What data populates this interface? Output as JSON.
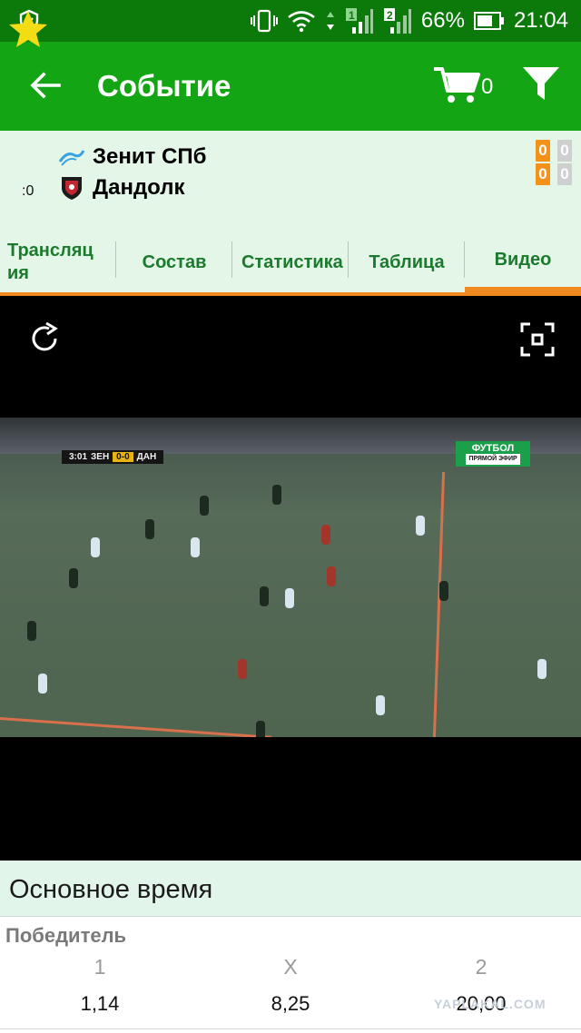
{
  "status_bar": {
    "battery_percent": "66%",
    "time": "21:04",
    "sim1_badge": "1",
    "sim2_badge": "2"
  },
  "app_bar": {
    "title": "Событие",
    "cart_count": "0"
  },
  "match": {
    "favorite_count": ":0",
    "team1": "Зенит СПб",
    "team2": "Дандолк",
    "score_current": [
      "0",
      "0"
    ],
    "score_other": [
      "0",
      "0"
    ]
  },
  "tabs": [
    {
      "label": "Трансляция",
      "active": false
    },
    {
      "label": "Состав",
      "active": false
    },
    {
      "label": "Статистика",
      "active": false
    },
    {
      "label": "Таблица",
      "active": false
    },
    {
      "label": "Видео",
      "active": true
    }
  ],
  "video": {
    "overlay_clock": "3:01",
    "overlay_team1": "ЗЕН",
    "overlay_score": "0-0",
    "overlay_team2": "ДАН",
    "channel_name": "ФУТБОЛ",
    "channel_sub": "ПРЯМОЙ ЭФИР"
  },
  "section": {
    "title": "Основное время"
  },
  "market": {
    "title": "Победитель",
    "outcomes": [
      {
        "label": "1",
        "odds": "1,14"
      },
      {
        "label": "X",
        "odds": "8,25"
      },
      {
        "label": "2",
        "odds": "20,00"
      }
    ]
  },
  "watermark": "YAPLAKAL.COM",
  "colors": {
    "status_bar": "#0b7a0b",
    "app_bar": "#14a514",
    "header_bg": "#e3f6e8",
    "tab_text": "#1c7a2d",
    "accent_orange": "#f08a1e",
    "score_orange": "#f3921b"
  },
  "icons": {
    "back": "arrow-left-icon",
    "cart": "shopping-cart-icon",
    "filter": "filter-funnel-icon",
    "favorite": "star-icon",
    "refresh": "refresh-icon",
    "fullscreen": "fullscreen-icon"
  }
}
